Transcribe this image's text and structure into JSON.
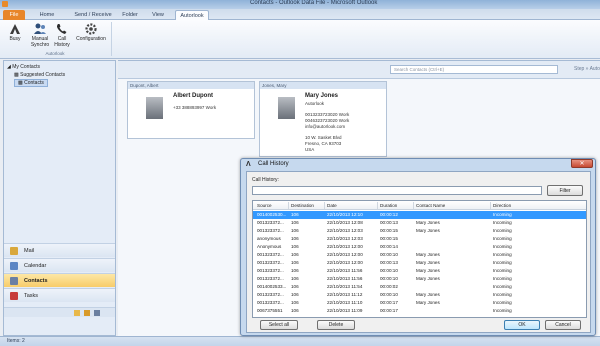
{
  "window": {
    "title": "Contacts - Outlook Data File - Microsoft Outlook"
  },
  "ribbon": {
    "tabs": [
      "File",
      "Home",
      "Send / Receive",
      "Folder",
      "View",
      "Autorlook"
    ],
    "active_tab": "Autorlook",
    "buttons": [
      {
        "label": "Busy",
        "icon": "autorlook-logo-icon"
      },
      {
        "label": "Manual Synchro",
        "icon": "people-sync-icon"
      },
      {
        "label": "Call History",
        "icon": "phone-history-icon"
      },
      {
        "label": "Configuration",
        "icon": "gear-icon"
      }
    ],
    "group_label": "Autorlook"
  },
  "nav": {
    "root": "My Contacts",
    "folders": [
      "Suggested Contacts",
      "Contacts"
    ],
    "sections": [
      "Mail",
      "Calendar",
      "Contacts",
      "Tasks"
    ],
    "active_section": "Contacts"
  },
  "main": {
    "search_placeholder": "Search Contacts (Ctrl+E)",
    "search_side": "Step » Auto",
    "cards": [
      {
        "header": "Dupont, Albert",
        "name": "Albert Dupont",
        "lines": [
          "+33 388893997 Work"
        ]
      },
      {
        "header": "Jones, Mary",
        "name": "Mary Jones",
        "lines": [
          "Autorlook",
          "",
          "0013233723020 Work",
          "0046323723020 Work",
          "info@autorlook.com",
          "",
          "10 W. Sasket Blvd",
          "Fresno, CA 93703",
          "USA"
        ]
      }
    ]
  },
  "status": {
    "items": "Items: 2"
  },
  "dialog": {
    "title": "Call History",
    "filter_label": "Call History:",
    "filter_button": "Filter",
    "columns": [
      "Source",
      "Destination",
      "Date",
      "Duration",
      "Contact Name",
      "Direction"
    ],
    "rows": [
      [
        "0014002530...",
        "106",
        "22/10/2013 12:10",
        "00:00:12",
        "",
        "Incoming"
      ],
      [
        "001323372...",
        "106",
        "22/10/2013 12:08",
        "00:00:13",
        "Mary Jones",
        "Incoming"
      ],
      [
        "001323372...",
        "106",
        "22/10/2013 12:03",
        "00:00:15",
        "Mary Jones",
        "Incoming"
      ],
      [
        "anonymous",
        "106",
        "22/10/2013 12:03",
        "00:00:15",
        "",
        "Incoming"
      ],
      [
        "Anonymous",
        "106",
        "22/10/2013 12:00",
        "00:00:14",
        "",
        "Incoming"
      ],
      [
        "001323372...",
        "106",
        "22/10/2013 12:00",
        "00:00:10",
        "Mary Jones",
        "Incoming"
      ],
      [
        "001323372...",
        "106",
        "22/10/2013 12:00",
        "00:00:13",
        "Mary Jones",
        "Incoming"
      ],
      [
        "001323372...",
        "106",
        "22/10/2013 11:56",
        "00:00:10",
        "Mary Jones",
        "Incoming"
      ],
      [
        "001323372...",
        "106",
        "22/10/2013 11:56",
        "00:00:10",
        "Mary Jones",
        "Incoming"
      ],
      [
        "0014002533...",
        "106",
        "22/10/2013 11:54",
        "00:00:02",
        "",
        "Incoming"
      ],
      [
        "001323372...",
        "106",
        "22/10/2013 11:12",
        "00:00:10",
        "Mary Jones",
        "Incoming"
      ],
      [
        "001323372...",
        "106",
        "22/10/2013 11:10",
        "00:00:17",
        "Mary Jones",
        "Incoming"
      ],
      [
        "0067375551",
        "106",
        "22/10/2013 11:09",
        "00:00:17",
        "",
        "Incoming"
      ]
    ],
    "selected_row": 0,
    "buttons": {
      "select_all": "Select all",
      "delete": "Delete",
      "ok": "OK",
      "cancel": "Cancel"
    }
  }
}
